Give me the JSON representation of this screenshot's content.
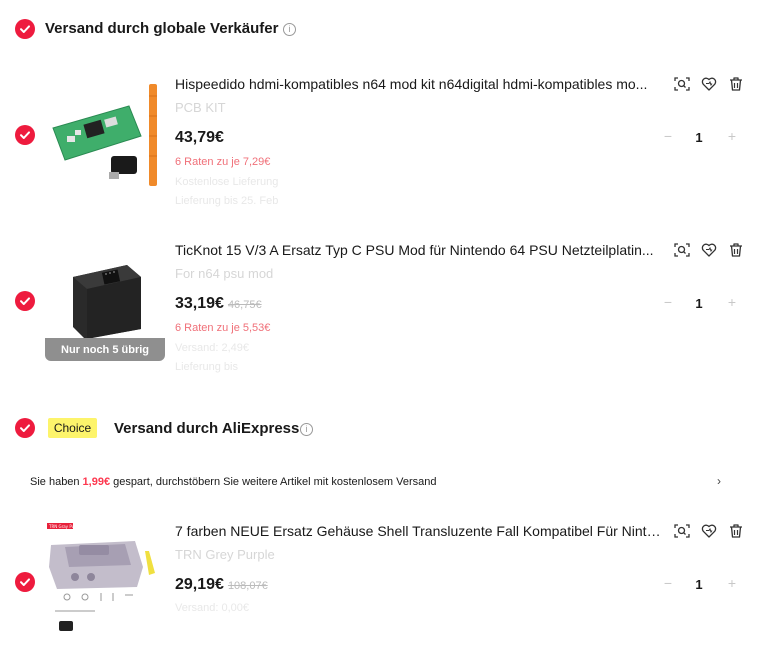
{
  "sections": {
    "global": {
      "title": "Versand durch globale Verkäufer"
    },
    "aliexpress": {
      "badge": "Choice",
      "title": "Versand durch AliExpress",
      "banner": {
        "prefix": "Sie haben",
        "amount": "1,99€",
        "suffix": "gespart, durchstöbern Sie weitere Artikel mit kostenlosem Versand"
      }
    }
  },
  "items": [
    {
      "title": "Hispeedido hdmi-kompatibles n64 mod kit n64digital hdmi-kompatibles mo...",
      "variant": "PCB KIT",
      "price": "43,79€",
      "old_price": "",
      "installment": "6 Raten zu je 7,29€",
      "faint_line1": "Kostenlose Lieferung",
      "faint_line2": "Lieferung bis 25. Feb",
      "quantity": "1"
    },
    {
      "title": "TicKnot 15 V/3 A Ersatz Typ C PSU Mod für Nintendo 64 PSU Netzteilplatin...",
      "variant": "For n64 psu mod",
      "price": "33,19€",
      "old_price": "46,75€",
      "installment": "6 Raten zu je 5,53€",
      "faint_line1": "Versand: 2,49€",
      "faint_line2": "Lieferung bis",
      "stock_badge": "Nur noch 5 übrig",
      "quantity": "1"
    },
    {
      "title": "7 farben NEUE Ersatz Gehäuse Shell Transluzente Fall Kompatibel Für Ninte...",
      "variant": "TRN Grey Purple",
      "price": "29,19€",
      "old_price": "108,07€",
      "image_tag": "TRN Gray Purple",
      "faint_line1": "Versand: 0,00€",
      "quantity": "1"
    }
  ],
  "icons": {
    "check": "check-icon",
    "info": "info-icon",
    "similar": "find-similar-icon",
    "wishlist": "heart-icon",
    "delete": "trash-icon",
    "chevron": "chevron-right-icon"
  },
  "colors": {
    "accent": "#ee1b3e",
    "installment": "#f07079",
    "choice_badge": "#fdf46b",
    "stock_badge": "#8f8f8f"
  }
}
